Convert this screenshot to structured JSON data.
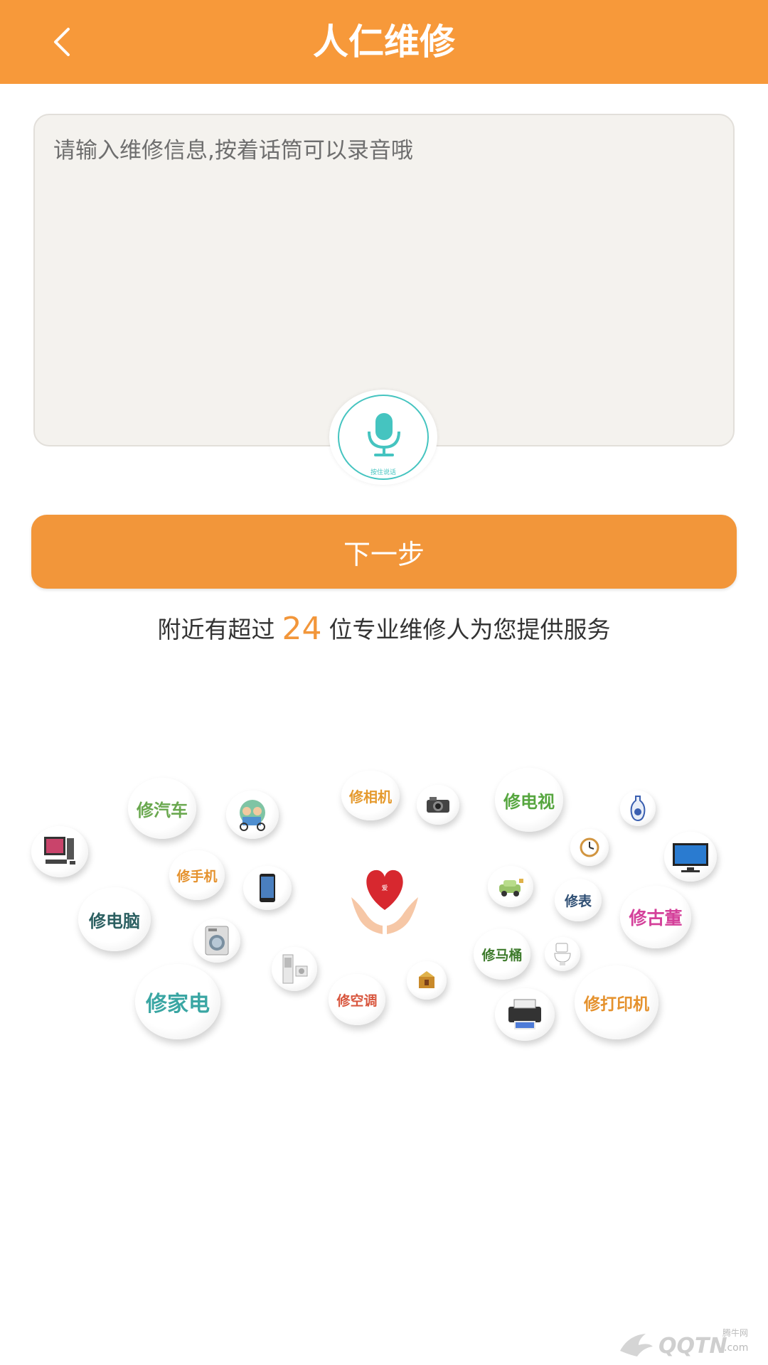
{
  "header": {
    "title": "人仁维修"
  },
  "input": {
    "placeholder": "请输入维修信息,按着话筒可以录音哦"
  },
  "mic": {
    "caption": "按住说话"
  },
  "next_button": {
    "label": "下一步"
  },
  "info": {
    "prefix": "附近有超过",
    "count": "24",
    "suffix": "位专业维修人为您提供服务"
  },
  "services": [
    {
      "label": "修汽车",
      "color": "#6aa84f"
    },
    {
      "label": "修相机",
      "color": "#e59a2e"
    },
    {
      "label": "修电视",
      "color": "#56a63f"
    },
    {
      "label": "修手机",
      "color": "#e5922e"
    },
    {
      "label": "修电脑",
      "color": "#2b5f61"
    },
    {
      "label": "修家电",
      "color": "#3aa6a3"
    },
    {
      "label": "修空调",
      "color": "#d8563e"
    },
    {
      "label": "修表",
      "color": "#2f4f74"
    },
    {
      "label": "修古董",
      "color": "#d4409a"
    },
    {
      "label": "修马桶",
      "color": "#3d7a2b"
    },
    {
      "label": "修打印机",
      "color": "#e5922e"
    }
  ],
  "heart_text": "爱",
  "watermark": {
    "text": "QQTN",
    "small": "腾牛网",
    "suffix": ".com"
  },
  "colors": {
    "primary": "#f7993a",
    "accent": "#45c4c0"
  }
}
